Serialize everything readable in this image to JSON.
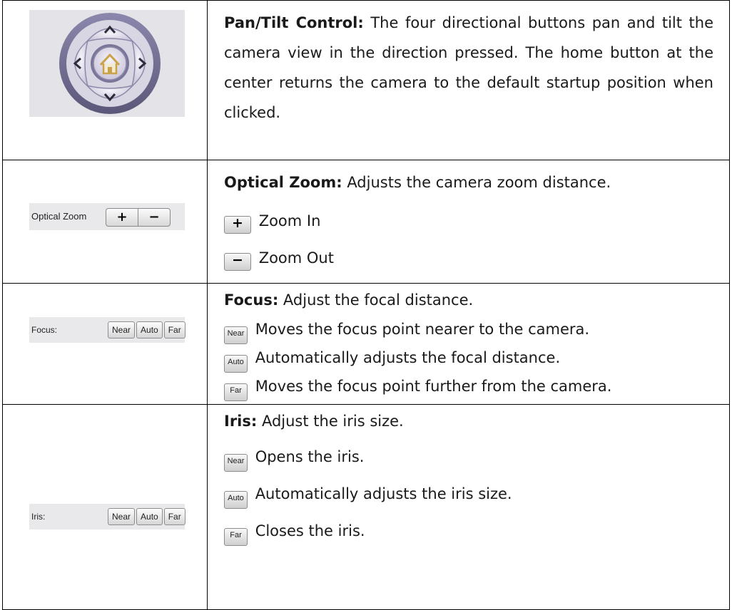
{
  "rows": {
    "pan_tilt": {
      "label": "Pan/Tilt Control:",
      "text": "The four directional buttons pan and tilt the camera view in the direction pressed. The home button at the center returns the camera to the default startup position when clicked."
    },
    "zoom": {
      "widget_caption": "Optical Zoom",
      "widget_plus": "+",
      "widget_minus": "−",
      "label": "Optical Zoom:",
      "text": "Adjusts the camera zoom distance.",
      "in_icon": "+",
      "in_text": "Zoom In",
      "out_icon": "−",
      "out_text": "Zoom Out"
    },
    "focus": {
      "widget_caption": "Focus:",
      "buttons": [
        "Near",
        "Auto",
        "Far"
      ],
      "label": "Focus:",
      "text": "Adjust the focal distance.",
      "items": [
        {
          "icon": "Near",
          "text": "Moves the focus point nearer to the camera."
        },
        {
          "icon": "Auto",
          "text": "Automatically adjusts the focal distance."
        },
        {
          "icon": "Far",
          "text": "Moves the focus point further from the camera."
        }
      ]
    },
    "iris": {
      "widget_caption": "Iris:",
      "buttons": [
        "Near",
        "Auto",
        "Far"
      ],
      "label": "Iris:",
      "text": "Adjust the iris size.",
      "items": [
        {
          "icon": "Near",
          "text": "Opens the iris."
        },
        {
          "icon": "Auto",
          "text": "Automatically adjusts the iris size."
        },
        {
          "icon": "Far",
          "text": "Closes the iris."
        }
      ]
    }
  },
  "colors": {
    "ring": "#6e6a8f",
    "button_fill": "#e8e5ef",
    "home_icon": "#c9a24a"
  },
  "icons": [
    "arrow-up-icon",
    "arrow-down-icon",
    "arrow-left-icon",
    "arrow-right-icon",
    "home-icon"
  ]
}
